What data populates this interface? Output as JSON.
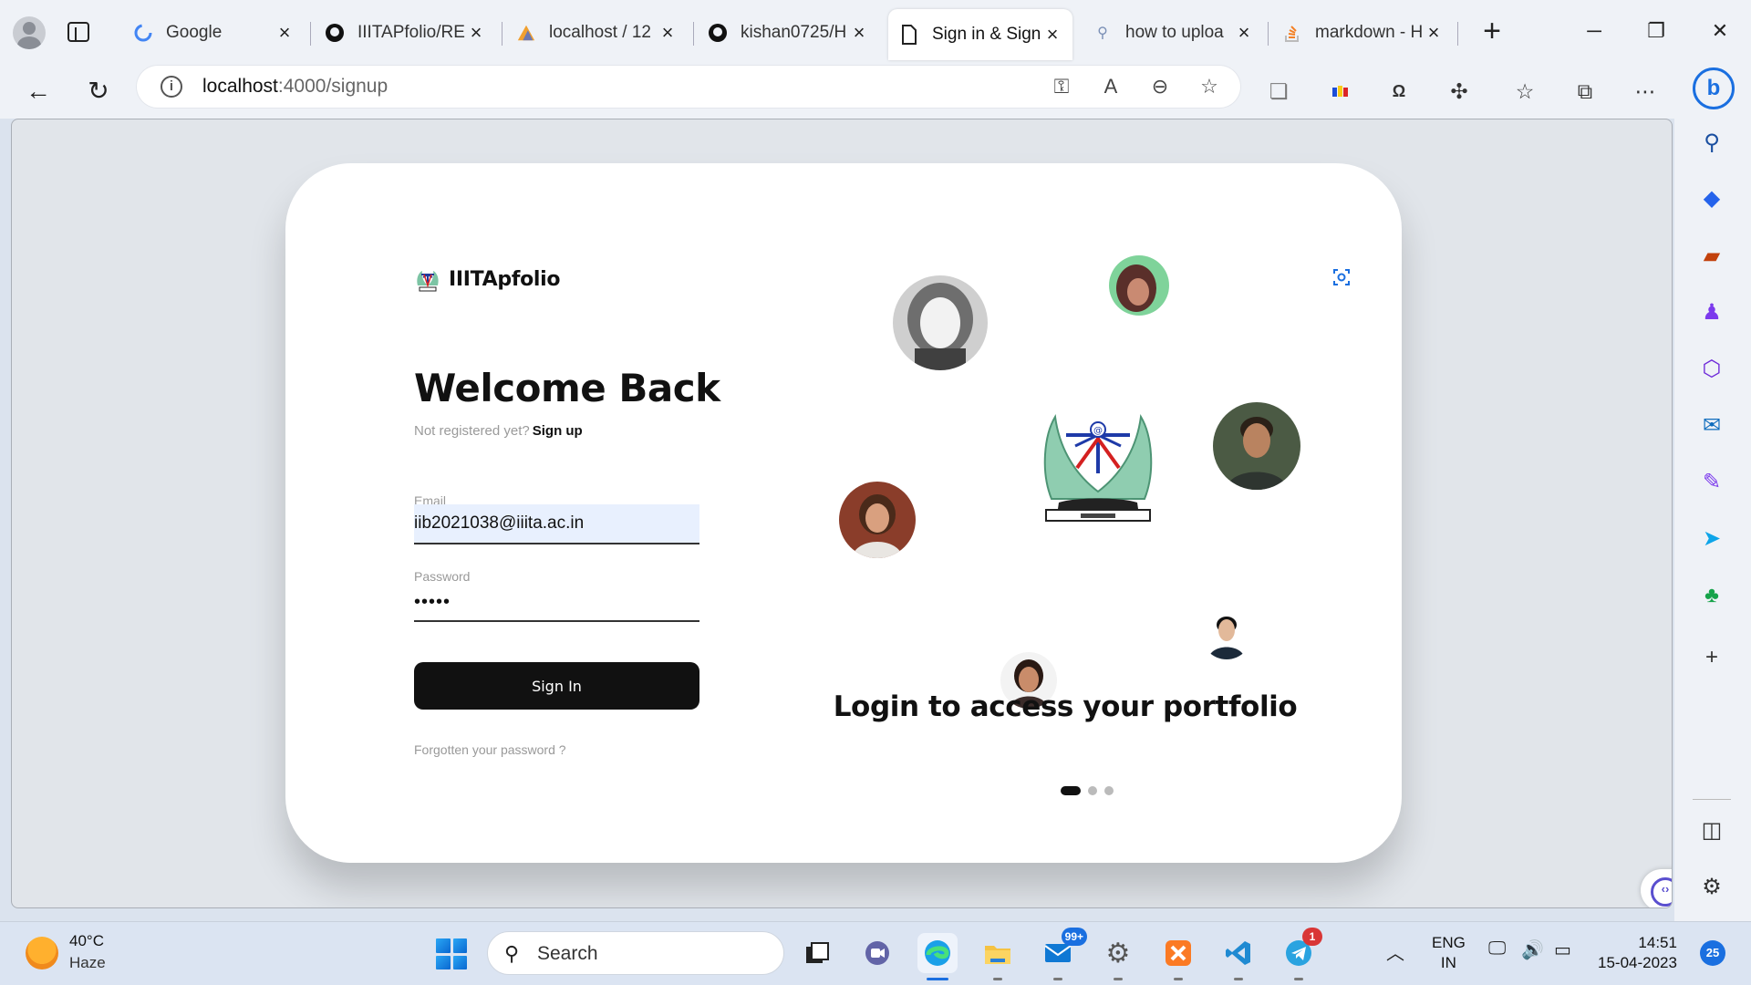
{
  "browser": {
    "tabs": [
      {
        "title": "Google",
        "favicon": "google-icon"
      },
      {
        "title": "IIITAPfolio/RE",
        "favicon": "github-icon"
      },
      {
        "title": "localhost / 12",
        "favicon": "phpmyadmin-icon"
      },
      {
        "title": "kishan0725/H",
        "favicon": "github-icon"
      },
      {
        "title": "Sign in & Sign",
        "favicon": "page-icon",
        "active": true
      },
      {
        "title": "how to uploa",
        "favicon": "search-icon"
      },
      {
        "title": "markdown - H",
        "favicon": "stackoverflow-icon"
      }
    ],
    "url_host": "localhost",
    "url_path": ":4000/signup"
  },
  "page": {
    "brand_name": "IIITApfolio",
    "heading": "Welcome Back",
    "not_registered_text": "Not registered yet?",
    "signup_link": "Sign up",
    "email_label": "Email",
    "email_value": "iib2021038@iiita.ac.in",
    "password_label": "Password",
    "password_value": "•••••",
    "signin_button": "Sign In",
    "forgot_link": "Forgotten your password ?",
    "tagline": "Login to access your portfolio",
    "carousel": {
      "count": 3,
      "active": 0
    }
  },
  "taskbar": {
    "weather_temp": "40°C",
    "weather_cond": "Haze",
    "search_placeholder": "Search",
    "mail_badge": "99+",
    "telegram_badge": "1",
    "lang_line1": "ENG",
    "lang_line2": "IN",
    "time": "14:51",
    "date": "15-04-2023",
    "notifications": "25"
  },
  "colors": {
    "accent": "#1a6fe0",
    "button": "#111111",
    "autofill": "#e8f0fe"
  }
}
